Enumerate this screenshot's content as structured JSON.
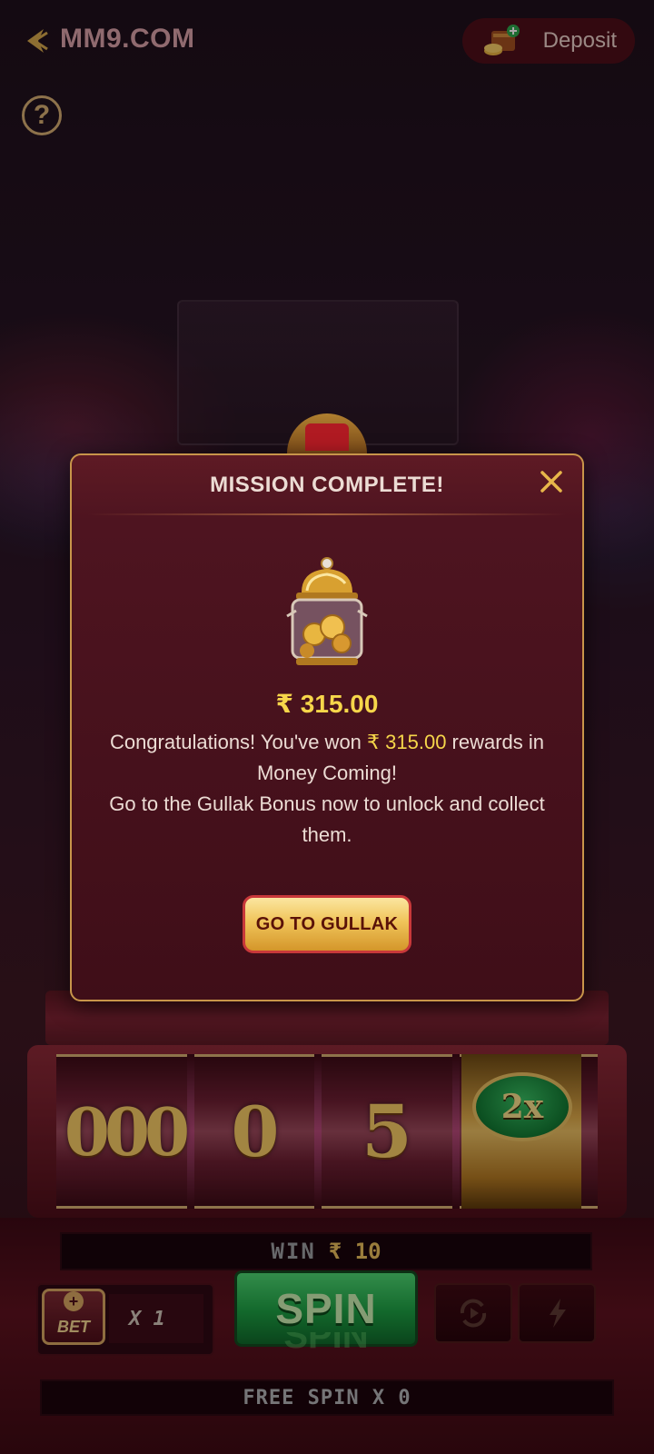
{
  "header": {
    "brand": "MM9.COM",
    "deposit_label": "Deposit",
    "help_label": "?"
  },
  "game": {
    "reels": [
      "000",
      "0",
      "5"
    ],
    "multiplier": "2x",
    "win_label": "WIN",
    "win_amount": "₹ 10",
    "bet_label": "BET",
    "bet_multiplier": "X 1",
    "spin_label": "SPIN",
    "free_spin_text": "FREE SPIN X 0"
  },
  "modal": {
    "title": "MISSION COMPLETE!",
    "reward_amount": "₹ 315.00",
    "message_pre": "Congratulations! You've won ",
    "message_amount": "₹ 315.00",
    "message_post": " rewards in Money Coming!",
    "message_line2": "Go to the Gullak Bonus now to unlock and collect them.",
    "button_label": "GO TO GULLAK"
  },
  "icons": {
    "back": "back-arrow-icon",
    "deposit": "wallet-coins-icon",
    "help": "help-icon",
    "close": "close-icon",
    "reward": "gullak-jar-icon",
    "autoplay": "autoplay-icon",
    "turbo": "lightning-icon"
  },
  "colors": {
    "accent_gold": "#f6d64a",
    "modal_bg": "#4e1420",
    "spin_green": "#18a040",
    "deposit_bg": "#4a0f16"
  }
}
